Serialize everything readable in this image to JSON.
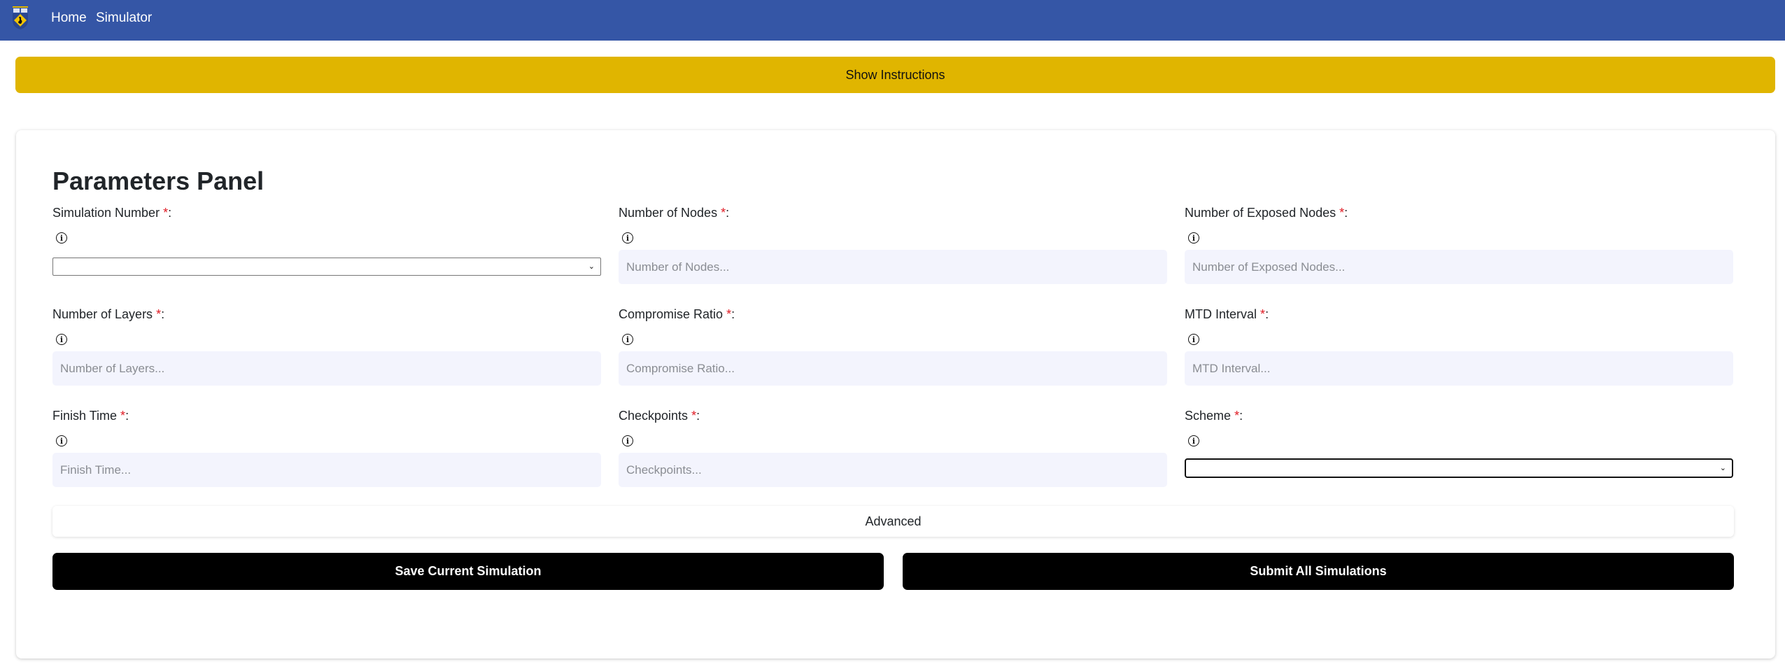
{
  "navbar": {
    "logo_icon": "university-crest-logo",
    "links": [
      {
        "label": "Home"
      },
      {
        "label": "Simulator"
      }
    ],
    "background_color": "#3556a6"
  },
  "instructions_button": {
    "label": "Show Instructions",
    "color": "#e0b500"
  },
  "panel": {
    "title": "Parameters Panel",
    "required_marker": "*",
    "info_icon": "info-circle-icon",
    "fields": [
      {
        "label": "Simulation Number",
        "type": "select",
        "value": "",
        "placeholder": ""
      },
      {
        "label": "Number of Nodes",
        "type": "input",
        "value": "",
        "placeholder": "Number of Nodes..."
      },
      {
        "label": "Number of Exposed Nodes",
        "type": "input",
        "value": "",
        "placeholder": "Number of Exposed Nodes..."
      },
      {
        "label": "Number of Layers",
        "type": "input",
        "value": "",
        "placeholder": "Number of Layers..."
      },
      {
        "label": "Compromise Ratio",
        "type": "input",
        "value": "",
        "placeholder": "Compromise Ratio..."
      },
      {
        "label": "MTD Interval",
        "type": "input",
        "value": "",
        "placeholder": "MTD Interval..."
      },
      {
        "label": "Finish Time",
        "type": "input",
        "value": "",
        "placeholder": "Finish Time..."
      },
      {
        "label": "Checkpoints",
        "type": "input",
        "value": "",
        "placeholder": "Checkpoints..."
      },
      {
        "label": "Scheme",
        "type": "select",
        "value": "",
        "placeholder": ""
      }
    ],
    "advanced_label": "Advanced",
    "save_label": "Save Current Simulation",
    "submit_label": "Submit All Simulations"
  }
}
